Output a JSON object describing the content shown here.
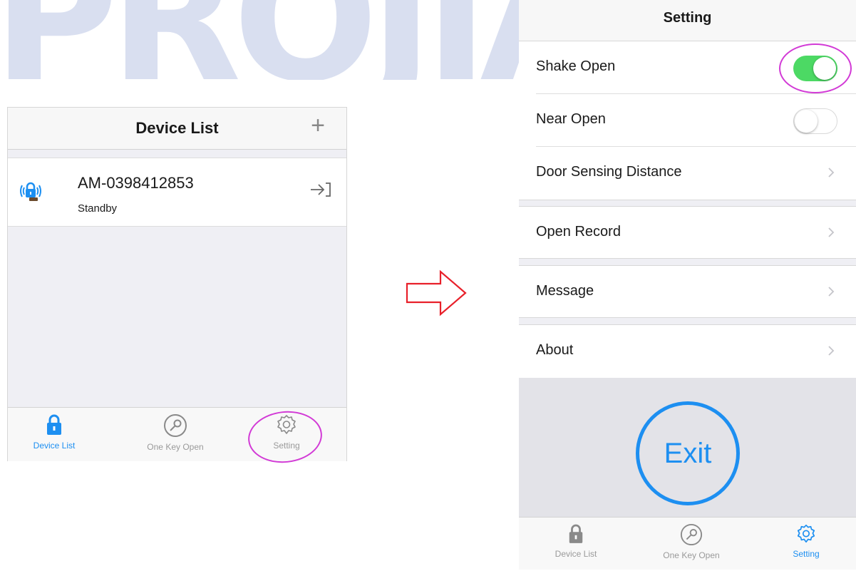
{
  "watermark": {
    "text": "PROJIAN"
  },
  "left_screen": {
    "title": "Device List",
    "add_symbol": "+",
    "device": {
      "name": "AM-0398412853",
      "status": "Standby"
    },
    "tabs": [
      {
        "label": "Device List",
        "icon": "lock-icon",
        "active": true
      },
      {
        "label": "One Key Open",
        "icon": "key-icon",
        "active": false
      },
      {
        "label": "Setting",
        "icon": "gear-icon",
        "active": false
      }
    ]
  },
  "right_screen": {
    "title": "Setting",
    "rows": [
      {
        "label": "Shake Open",
        "control": "toggle",
        "value": true
      },
      {
        "label": "Near Open",
        "control": "toggle",
        "value": false
      },
      {
        "label": "Door Sensing Distance",
        "control": "chevron"
      },
      {
        "label": "Open Record",
        "control": "chevron"
      },
      {
        "label": "Message",
        "control": "chevron"
      },
      {
        "label": "About",
        "control": "chevron"
      }
    ],
    "exit_label": "Exit",
    "tabs": [
      {
        "label": "Device List",
        "icon": "lock-icon",
        "active": false
      },
      {
        "label": "One Key Open",
        "icon": "key-icon",
        "active": false
      },
      {
        "label": "Setting",
        "icon": "gear-icon",
        "active": true
      }
    ]
  },
  "colors": {
    "active_tab": "#1d8ff1",
    "inactive_tab": "#9a9a9a",
    "toggle_on": "#4cd964",
    "highlight": "#d23ad6",
    "arrow": "#e8202a"
  }
}
